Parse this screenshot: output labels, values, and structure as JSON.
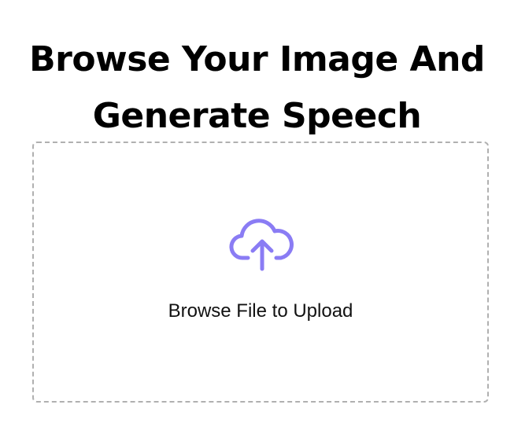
{
  "heading": {
    "line1": "Browse Your Image And",
    "line2": "Generate Speech"
  },
  "upload": {
    "label": "Browse File to Upload",
    "icon": "cloud-upload-icon",
    "icon_color": "#8a7cf4",
    "border_color": "#b0b0b0"
  }
}
